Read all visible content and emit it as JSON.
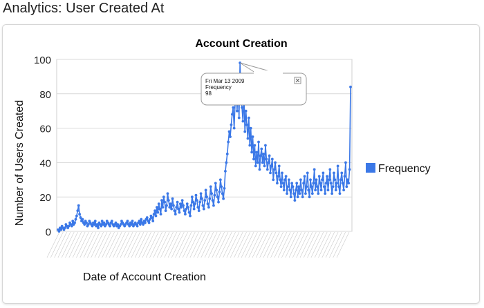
{
  "page": {
    "title": "Analytics: User Created At"
  },
  "tooltip": {
    "date": "Fri Mar 13 2009",
    "series": "Frequency",
    "value": "98",
    "close_icon": "close-icon"
  },
  "chart_data": {
    "type": "line",
    "title": "Account Creation",
    "xlabel": "Date of Account Creation",
    "ylabel": "Number of Users Created",
    "ylim": [
      0,
      100
    ],
    "yticks": [
      0,
      20,
      40,
      60,
      80,
      100
    ],
    "grid": true,
    "legend": "right",
    "color": "#3b78e7",
    "series": [
      {
        "name": "Frequency",
        "values": [
          1,
          0,
          2,
          1,
          3,
          2,
          1,
          2,
          4,
          3,
          2,
          3,
          5,
          4,
          3,
          6,
          4,
          5,
          7,
          9,
          12,
          15,
          10,
          8,
          6,
          7,
          5,
          4,
          6,
          5,
          3,
          4,
          6,
          5,
          4,
          3,
          5,
          4,
          6,
          3,
          4,
          2,
          5,
          4,
          3,
          6,
          4,
          5,
          3,
          4,
          6,
          5,
          4,
          3,
          5,
          6,
          4,
          3,
          4,
          5,
          3,
          4,
          2,
          3,
          4,
          6,
          5,
          4,
          3,
          4,
          5,
          6,
          4,
          3,
          5,
          4,
          6,
          3,
          4,
          5,
          4,
          3,
          5,
          6,
          4,
          7,
          5,
          4,
          6,
          5,
          7,
          8,
          6,
          5,
          7,
          9,
          8,
          6,
          10,
          12,
          9,
          14,
          11,
          16,
          13,
          10,
          18,
          14,
          20,
          17,
          12,
          15,
          22,
          18,
          14,
          16,
          13,
          19,
          15,
          12,
          10,
          14,
          17,
          13,
          11,
          16,
          14,
          18,
          15,
          12,
          10,
          13,
          16,
          14,
          11,
          9,
          15,
          20,
          17,
          13,
          16,
          21,
          18,
          14,
          12,
          17,
          22,
          19,
          15,
          13,
          18,
          24,
          20,
          16,
          14,
          19,
          26,
          22,
          18,
          15,
          21,
          28,
          24,
          20,
          17,
          23,
          30,
          26,
          22,
          19,
          25,
          35,
          40,
          45,
          52,
          58,
          55,
          62,
          68,
          72,
          60,
          75,
          80,
          70,
          85,
          66,
          98,
          78,
          72,
          64,
          80,
          58,
          70,
          62,
          54,
          66,
          50,
          60,
          46,
          55,
          42,
          50,
          38,
          46,
          40,
          52,
          36,
          44,
          48,
          40,
          45,
          38,
          50,
          42,
          36,
          40,
          44,
          34,
          38,
          42,
          30,
          36,
          40,
          34,
          28,
          32,
          38,
          30,
          26,
          34,
          28,
          24,
          30,
          32,
          22,
          26,
          30,
          24,
          20,
          28,
          26,
          22,
          18,
          24,
          28,
          20,
          26,
          22,
          30,
          24,
          20,
          28,
          32,
          22,
          26,
          34,
          24,
          20,
          30,
          26,
          22,
          28,
          36,
          24,
          30,
          26,
          22,
          32,
          28,
          24,
          30,
          34,
          26,
          22,
          28,
          32,
          24,
          30,
          36,
          28,
          22,
          26,
          34,
          30,
          24,
          28,
          38,
          26,
          22,
          30,
          34,
          28,
          24,
          32,
          40,
          26,
          30,
          28,
          36,
          84
        ]
      }
    ]
  }
}
